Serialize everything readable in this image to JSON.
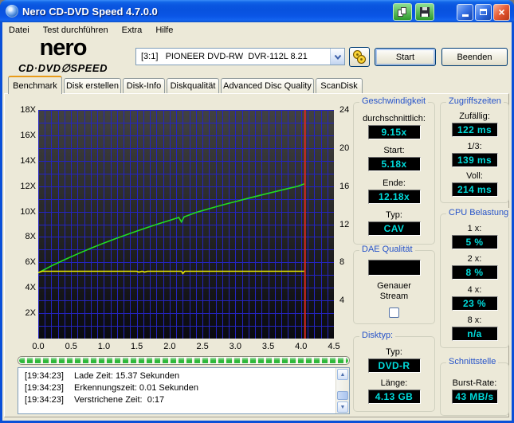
{
  "window": {
    "title": "Nero CD-DVD Speed 4.7.0.0"
  },
  "icons": {
    "app-icon": "disc",
    "copy-results-icon": "two-pages",
    "save-results-icon": "floppy-disk",
    "minimize-icon": "underscore",
    "maximize-icon": "square",
    "close-icon": "×",
    "drive-speed-icon": "two-yellow-discs",
    "combo-arrow-icon": "▼",
    "scroll-up-icon": "▲",
    "scroll-down-icon": "▼"
  },
  "menu": {
    "items": [
      "Datei",
      "Test durchführen",
      "Extra",
      "Hilfe"
    ]
  },
  "logo": {
    "line1": "nero",
    "line2": "CD·DVD∅SPEED"
  },
  "header": {
    "drive_select": {
      "value": "[3:1]   PIONEER DVD-RW  DVR-112L 8.21"
    },
    "start_label": "Start",
    "quit_label": "Beenden"
  },
  "tabs": {
    "active_index": 0,
    "items": [
      "Benchmark",
      "Disk erstellen",
      "Disk-Info",
      "Diskqualität",
      "Advanced Disc Quality",
      "ScanDisk"
    ]
  },
  "chart_data": {
    "type": "line",
    "xlim": [
      0,
      4.5
    ],
    "ylim_left": [
      0,
      18
    ],
    "ylim_right": [
      0,
      24
    ],
    "grid": {
      "x_step": 0.1,
      "y_step": 1,
      "color": "#2424C0"
    },
    "bg_gradient": [
      "#424242",
      "#0A0A10"
    ],
    "x_ticks": [
      {
        "v": 0,
        "t": "0.0"
      },
      {
        "v": 0.5,
        "t": "0.5"
      },
      {
        "v": 1,
        "t": "1.0"
      },
      {
        "v": 1.5,
        "t": "1.5"
      },
      {
        "v": 2,
        "t": "2.0"
      },
      {
        "v": 2.5,
        "t": "2.5"
      },
      {
        "v": 3,
        "t": "3.0"
      },
      {
        "v": 3.5,
        "t": "3.5"
      },
      {
        "v": 4,
        "t": "4.0"
      },
      {
        "v": 4.5,
        "t": "4.5"
      }
    ],
    "left_ticks": [
      {
        "v": 18,
        "t": "18X"
      },
      {
        "v": 16,
        "t": "16X"
      },
      {
        "v": 14,
        "t": "14X"
      },
      {
        "v": 12,
        "t": "12X"
      },
      {
        "v": 10,
        "t": "10X"
      },
      {
        "v": 8,
        "t": "8X"
      },
      {
        "v": 6,
        "t": "6X"
      },
      {
        "v": 4,
        "t": "4X"
      },
      {
        "v": 2,
        "t": "2X"
      }
    ],
    "right_ticks": [
      {
        "v": 24,
        "t": "24"
      },
      {
        "v": 20,
        "t": "20"
      },
      {
        "v": 16,
        "t": "16"
      },
      {
        "v": 12,
        "t": "12"
      },
      {
        "v": 8,
        "t": "8"
      },
      {
        "v": 4,
        "t": "4"
      }
    ],
    "series": [
      {
        "name": "transfer-rate",
        "color": "#21DD21",
        "points": [
          [
            0,
            5.18
          ],
          [
            0.2,
            5.72
          ],
          [
            0.4,
            6.21
          ],
          [
            0.6,
            6.67
          ],
          [
            0.8,
            7.11
          ],
          [
            1.0,
            7.52
          ],
          [
            1.2,
            7.91
          ],
          [
            1.4,
            8.28
          ],
          [
            1.6,
            8.64
          ],
          [
            1.8,
            8.98
          ],
          [
            2.0,
            9.31
          ],
          [
            2.14,
            9.53
          ],
          [
            2.18,
            9.18
          ],
          [
            2.22,
            9.58
          ],
          [
            2.4,
            9.93
          ],
          [
            2.6,
            10.22
          ],
          [
            2.8,
            10.51
          ],
          [
            3.0,
            10.78
          ],
          [
            3.2,
            11.05
          ],
          [
            3.4,
            11.31
          ],
          [
            3.6,
            11.56
          ],
          [
            3.8,
            11.81
          ],
          [
            3.95,
            11.99
          ],
          [
            4.05,
            12.18
          ]
        ]
      },
      {
        "name": "rotation-speed",
        "color": "#E8E800",
        "points": [
          [
            0,
            5.2
          ],
          [
            0.06,
            5.3
          ],
          [
            1.5,
            5.3
          ],
          [
            1.53,
            5.23
          ],
          [
            1.58,
            5.3
          ],
          [
            1.62,
            5.24
          ],
          [
            1.66,
            5.3
          ],
          [
            2.18,
            5.3
          ],
          [
            2.2,
            5.12
          ],
          [
            2.23,
            5.3
          ],
          [
            4.05,
            5.3
          ]
        ]
      }
    ],
    "end_line": {
      "x": 4.06,
      "color": "#DD2A1E"
    }
  },
  "progress": {
    "percent": 100
  },
  "log": {
    "lines": [
      {
        "time": "[19:34:23]",
        "text": "Lade Zeit: 15.37 Sekunden"
      },
      {
        "time": "[19:34:23]",
        "text": "Erkennungszeit: 0.01 Sekunden"
      },
      {
        "time": "[19:34:23]",
        "text": "Verstrichene Zeit:  0:17"
      }
    ]
  },
  "panels": {
    "speed": {
      "title": "Geschwindigkeit",
      "fields": [
        {
          "label": "durchschnittlich:",
          "value": "9.15x"
        },
        {
          "label": "Start:",
          "value": "5.18x"
        },
        {
          "label": "Ende:",
          "value": "12.18x"
        },
        {
          "label": "Typ:",
          "value": "CAV"
        }
      ]
    },
    "dae": {
      "title": "DAE Qualität",
      "display": "",
      "label_line1": "Genauer",
      "label_line2": "Stream",
      "checked": false
    },
    "disc": {
      "title": "Disktyp:",
      "fields": [
        {
          "label": "Typ:",
          "value": "DVD-R"
        },
        {
          "label": "Länge:",
          "value": "4.13 GB"
        }
      ]
    },
    "access": {
      "title": "Zugriffszeiten",
      "fields": [
        {
          "label": "Zufällig:",
          "value": "122 ms"
        },
        {
          "label": "1/3:",
          "value": "139 ms"
        },
        {
          "label": "Voll:",
          "value": "214 ms"
        }
      ]
    },
    "cpu": {
      "title": "CPU Belastung",
      "fields": [
        {
          "label": "1 x:",
          "value": "5 %"
        },
        {
          "label": "2 x:",
          "value": "8 %"
        },
        {
          "label": "4 x:",
          "value": "23 %"
        },
        {
          "label": "8 x:",
          "value": "n/a"
        }
      ]
    },
    "interface": {
      "title": "Schnittstelle",
      "fields": [
        {
          "label": "Burst-Rate:",
          "value": "43 MB/s"
        }
      ]
    }
  }
}
